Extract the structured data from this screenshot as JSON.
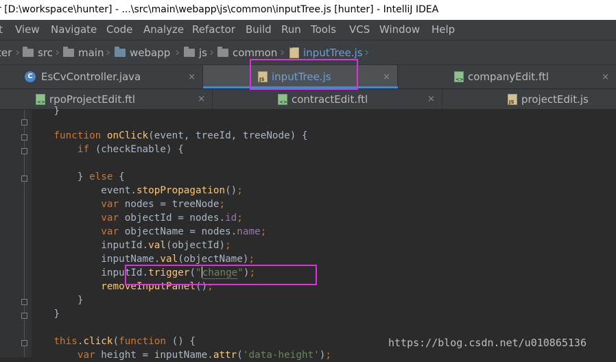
{
  "window": {
    "title": "r [D:\\workspace\\hunter] - ...\\src\\main\\webapp\\js\\common\\inputTree.js [hunter] - IntelliJ IDEA"
  },
  "menu": [
    "t",
    "View",
    "Navigate",
    "Code",
    "Analyze",
    "Refactor",
    "Build",
    "Run",
    "Tools",
    "VCS",
    "Window",
    "Help"
  ],
  "breadcrumbs": [
    "ter",
    "src",
    "main",
    "webapp",
    "js",
    "common",
    "inputTree.js"
  ],
  "tabs_row1": [
    {
      "label": "EsCvController.java",
      "icon": "java-class-icon"
    },
    {
      "label": "inputTree.js",
      "icon": "js-file-icon",
      "active": true
    },
    {
      "label": "companyEdit.ftl",
      "icon": "ftl-file-icon"
    }
  ],
  "tabs_row2": [
    {
      "label": "rpoProjectEdit.ftl",
      "icon": "ftl-file-icon"
    },
    {
      "label": "contractEdit.ftl",
      "icon": "ftl-file-icon"
    },
    {
      "label": "projectEdit.js",
      "icon": "js-file-icon"
    }
  ],
  "close_glyph": "×",
  "code_lines": [
    "    }",
    "",
    "    function onClick(event, treeId, treeNode) {",
    "        if (checkEnable) {",
    "",
    "        } else {",
    "            event.stopPropagation();",
    "            var nodes = treeNode;",
    "            var objectId = nodes.id;",
    "            var objectName = nodes.name;",
    "            inputId.val(objectId);",
    "            inputName.val(objectName);",
    "            inputId.trigger(\"change\");",
    "            removeInputPanel();",
    "        }",
    "    }",
    "",
    "    this.click(function () {",
    "        var height = inputName.attr('data-height');"
  ],
  "watermark": "https://blog.csdn.net/u010865136",
  "colors": {
    "highlight": "#e030e0",
    "keyword": "#cc7832",
    "function": "#ffc66d",
    "string": "#6a8759",
    "property": "#9876aa"
  }
}
